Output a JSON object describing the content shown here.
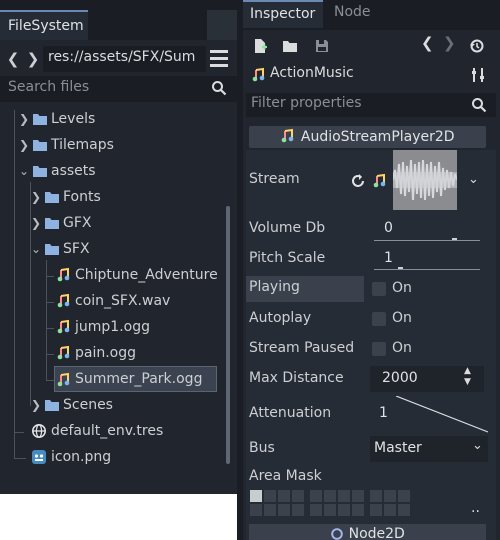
{
  "filesystem": {
    "tab_label": "FileSystem",
    "path": "res://assets/SFX/Sum",
    "search_placeholder": "Search files",
    "tree": [
      {
        "label": "Levels",
        "type": "folder"
      },
      {
        "label": "Tilemaps",
        "type": "folder"
      },
      {
        "label": "assets",
        "type": "folder"
      },
      {
        "label": "Fonts",
        "type": "folder"
      },
      {
        "label": "GFX",
        "type": "folder"
      },
      {
        "label": "SFX",
        "type": "folder"
      },
      {
        "label": "Chiptune_Adventure",
        "type": "audio"
      },
      {
        "label": "coin_SFX.wav",
        "type": "audio"
      },
      {
        "label": "jump1.ogg",
        "type": "audio"
      },
      {
        "label": "pain.ogg",
        "type": "audio"
      },
      {
        "label": "Summer_Park.ogg",
        "type": "audio",
        "selected": true
      },
      {
        "label": "Scenes",
        "type": "folder"
      },
      {
        "label": "default_env.tres",
        "type": "resource"
      },
      {
        "label": "icon.png",
        "type": "image"
      }
    ]
  },
  "inspector": {
    "tabs": [
      {
        "label": "Inspector",
        "active": true
      },
      {
        "label": "Node",
        "active": false
      }
    ],
    "object_name": "ActionMusic",
    "filter_placeholder": "Filter properties",
    "section_title": "AudioStreamPlayer2D",
    "properties": {
      "stream_label": "Stream",
      "volume_label": "Volume Db",
      "volume_value": "0",
      "pitch_label": "Pitch Scale",
      "pitch_value": "1",
      "playing_label": "Playing",
      "playing_value": "On",
      "autoplay_label": "Autoplay",
      "autoplay_value": "On",
      "paused_label": "Stream Paused",
      "paused_value": "On",
      "max_distance_label": "Max Distance",
      "max_distance_value": "2000",
      "attenuation_label": "Attenuation",
      "attenuation_value": "1",
      "bus_label": "Bus",
      "bus_value": "Master",
      "area_mask_label": "Area Mask",
      "area_mask_more": ".."
    },
    "next_section": "Node2D"
  },
  "colors": {
    "panel_bg": "#21262e",
    "folder": "#8fb3e0",
    "accent": "#6a8ab3"
  }
}
